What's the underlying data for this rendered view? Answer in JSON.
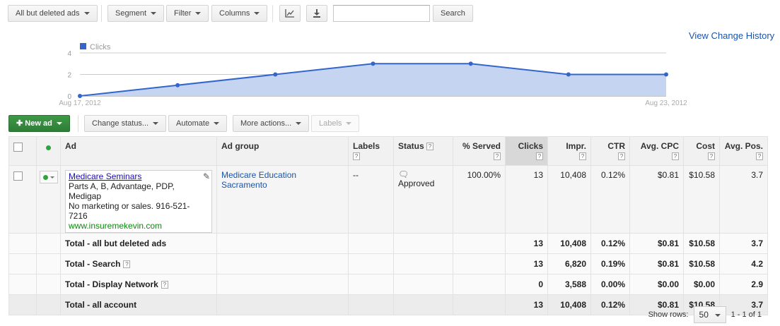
{
  "toolbar": {
    "filter_dropdown": "All but deleted ads",
    "segment": "Segment",
    "filter": "Filter",
    "columns": "Columns",
    "search_value": "",
    "search_button": "Search"
  },
  "view_change_history": "View Change History",
  "chart_data": {
    "type": "area",
    "series": [
      {
        "name": "Clicks",
        "values": [
          0,
          1,
          2,
          3,
          3,
          2,
          2
        ],
        "color": "#3366cc"
      }
    ],
    "x": [
      "Aug 17, 2012",
      "Aug 18, 2012",
      "Aug 19, 2012",
      "Aug 20, 2012",
      "Aug 21, 2012",
      "Aug 22, 2012",
      "Aug 23, 2012"
    ],
    "x_tick_labels": [
      "Aug 17, 2012",
      "Aug 23, 2012"
    ],
    "y_ticks": [
      "0",
      "2",
      "4"
    ],
    "ylim": [
      0,
      4
    ],
    "legend": "top-left",
    "grid": true
  },
  "ad_toolbar": {
    "new_ad": "New ad",
    "change_status": "Change status...",
    "automate": "Automate",
    "more_actions": "More actions...",
    "labels": "Labels"
  },
  "table": {
    "headers": {
      "ad": "Ad",
      "ad_group": "Ad group",
      "labels": "Labels",
      "status": "Status",
      "served": "% Served",
      "clicks": "Clicks",
      "impr": "Impr.",
      "ctr": "CTR",
      "avg_cpc": "Avg. CPC",
      "cost": "Cost",
      "avg_pos": "Avg. Pos."
    },
    "help_glyph": "?",
    "ad_row": {
      "headline": "Medicare Seminars",
      "line1": "Parts A, B, Advantage, PDP, Medigap",
      "line2": "No marketing or sales. 916-521-7216",
      "display_url": "www.insuremekevin.com",
      "ad_group_line1": "Medicare Education",
      "ad_group_line2": "Sacramento",
      "labels": "--",
      "status": "Approved",
      "served": "100.00%",
      "clicks": "13",
      "impr": "10,408",
      "ctr": "0.12%",
      "avg_cpc": "$0.81",
      "cost": "$10.58",
      "avg_pos": "3.7"
    },
    "totals": [
      {
        "label": "Total - all but deleted ads",
        "clicks": "13",
        "impr": "10,408",
        "ctr": "0.12%",
        "avg_cpc": "$0.81",
        "cost": "$10.58",
        "avg_pos": "3.7"
      },
      {
        "label": "Total - Search",
        "clicks": "13",
        "impr": "6,820",
        "ctr": "0.19%",
        "avg_cpc": "$0.81",
        "cost": "$10.58",
        "avg_pos": "4.2"
      },
      {
        "label": "Total - Display Network",
        "clicks": "0",
        "impr": "3,588",
        "ctr": "0.00%",
        "avg_cpc": "$0.00",
        "cost": "$0.00",
        "avg_pos": "2.9"
      },
      {
        "label": "Total - all account",
        "clicks": "13",
        "impr": "10,408",
        "ctr": "0.12%",
        "avg_cpc": "$0.81",
        "cost": "$10.58",
        "avg_pos": "3.7"
      }
    ]
  },
  "footer": {
    "show_rows_label": "Show rows:",
    "rows_value": "50",
    "pagination": "1 - 1 of 1"
  }
}
